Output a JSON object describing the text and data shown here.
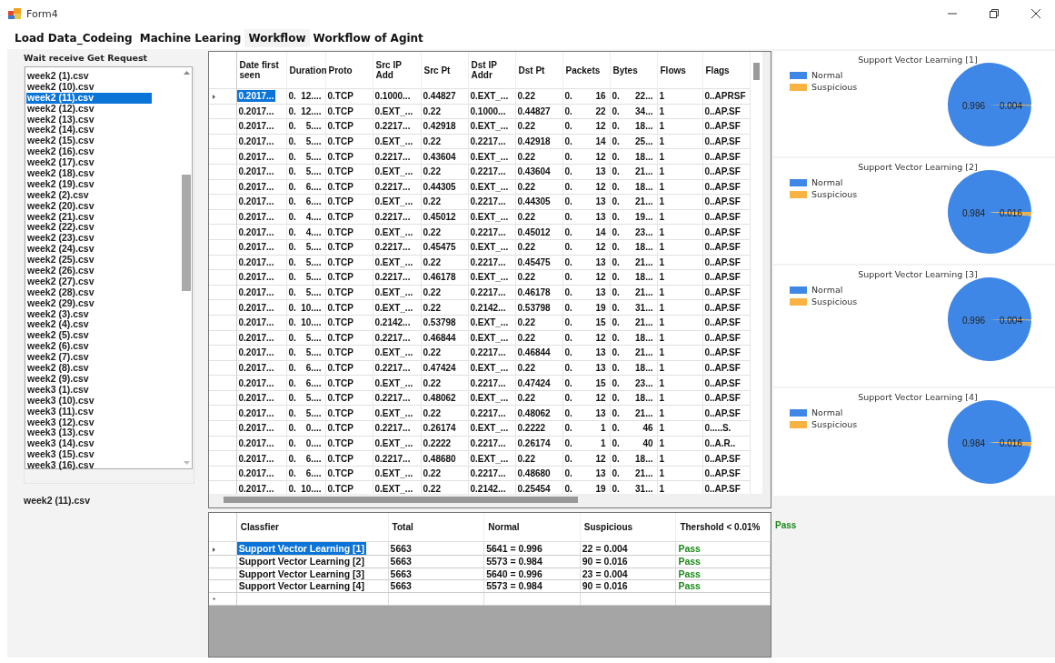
{
  "window": {
    "title": "Form4"
  },
  "tabs": [
    {
      "label": "Load Data_Codeing",
      "selected": false
    },
    {
      "label": "Machine Learing",
      "selected": false
    },
    {
      "label": "Workflow",
      "selected": true
    },
    {
      "label": "Workflow of Agint",
      "selected": false
    }
  ],
  "file_list": {
    "label": "Wait  receive Get Request",
    "current_file": "week2 (11).csv",
    "items": [
      {
        "name": "week2 (1).csv",
        "selected": false
      },
      {
        "name": "week2 (10).csv",
        "selected": false
      },
      {
        "name": "week2 (11).csv",
        "selected": true
      },
      {
        "name": "week2 (12).csv",
        "selected": false
      },
      {
        "name": "week2 (13).csv",
        "selected": false
      },
      {
        "name": "week2 (14).csv",
        "selected": false
      },
      {
        "name": "week2 (15).csv",
        "selected": false
      },
      {
        "name": "week2 (16).csv",
        "selected": false
      },
      {
        "name": "week2 (17).csv",
        "selected": false
      },
      {
        "name": "week2 (18).csv",
        "selected": false
      },
      {
        "name": "week2 (19).csv",
        "selected": false
      },
      {
        "name": "week2 (2).csv",
        "selected": false
      },
      {
        "name": "week2 (20).csv",
        "selected": false
      },
      {
        "name": "week2 (21).csv",
        "selected": false
      },
      {
        "name": "week2 (22).csv",
        "selected": false
      },
      {
        "name": "week2 (23).csv",
        "selected": false
      },
      {
        "name": "week2 (24).csv",
        "selected": false
      },
      {
        "name": "week2 (25).csv",
        "selected": false
      },
      {
        "name": "week2 (26).csv",
        "selected": false
      },
      {
        "name": "week2 (27).csv",
        "selected": false
      },
      {
        "name": "week2 (28).csv",
        "selected": false
      },
      {
        "name": "week2 (29).csv",
        "selected": false
      },
      {
        "name": "week2 (3).csv",
        "selected": false
      },
      {
        "name": "week2 (4).csv",
        "selected": false
      },
      {
        "name": "week2 (5).csv",
        "selected": false
      },
      {
        "name": "week2 (6).csv",
        "selected": false
      },
      {
        "name": "week2 (7).csv",
        "selected": false
      },
      {
        "name": "week2 (8).csv",
        "selected": false
      },
      {
        "name": "week2 (9).csv",
        "selected": false
      },
      {
        "name": "week3 (1).csv",
        "selected": false
      },
      {
        "name": "week3 (10).csv",
        "selected": false
      },
      {
        "name": "week3 (11).csv",
        "selected": false
      },
      {
        "name": "week3 (12).csv",
        "selected": false
      },
      {
        "name": "week3 (13).csv",
        "selected": false
      },
      {
        "name": "week3 (14).csv",
        "selected": false
      },
      {
        "name": "week3 (15).csv",
        "selected": false
      },
      {
        "name": "week3 (16).csv",
        "selected": false
      }
    ]
  },
  "flow_table": {
    "columns": [
      "Date first seen",
      "Duration",
      "Proto",
      "Src IP Add",
      "Src Pt",
      "Dst IP Addr",
      "Dst Pt",
      "Packets",
      "Bytes",
      "Flows",
      "Flags"
    ],
    "rows": [
      {
        "selected": true,
        "cells": [
          "0.2017...",
          [
            "0.",
            "12...."
          ],
          "0.TCP",
          "0.1000...",
          "0.44827",
          "0.EXT_...",
          "0.22",
          [
            "0.",
            "16"
          ],
          [
            "0.",
            "22..."
          ],
          "1",
          "0..APRSF"
        ]
      },
      {
        "selected": false,
        "cells": [
          "0.2017...",
          [
            "0.",
            "12...."
          ],
          "0.TCP",
          "0.EXT_...",
          "0.22",
          "0.1000...",
          "0.44827",
          [
            "0.",
            "22"
          ],
          [
            "0.",
            "34..."
          ],
          "1",
          "0..AP.SF"
        ]
      },
      {
        "selected": false,
        "cells": [
          "0.2017...",
          [
            "0.",
            "5...."
          ],
          "0.TCP",
          "0.2217...",
          "0.42918",
          "0.EXT_...",
          "0.22",
          [
            "0.",
            "12"
          ],
          [
            "0.",
            "18..."
          ],
          "1",
          "0..AP.SF"
        ]
      },
      {
        "selected": false,
        "cells": [
          "0.2017...",
          [
            "0.",
            "5...."
          ],
          "0.TCP",
          "0.EXT_...",
          "0.22",
          "0.2217...",
          "0.42918",
          [
            "0.",
            "14"
          ],
          [
            "0.",
            "25..."
          ],
          "1",
          "0..AP.SF"
        ]
      },
      {
        "selected": false,
        "cells": [
          "0.2017...",
          [
            "0.",
            "5...."
          ],
          "0.TCP",
          "0.2217...",
          "0.43604",
          "0.EXT_...",
          "0.22",
          [
            "0.",
            "12"
          ],
          [
            "0.",
            "18..."
          ],
          "1",
          "0..AP.SF"
        ]
      },
      {
        "selected": false,
        "cells": [
          "0.2017...",
          [
            "0.",
            "5...."
          ],
          "0.TCP",
          "0.EXT_...",
          "0.22",
          "0.2217...",
          "0.43604",
          [
            "0.",
            "13"
          ],
          [
            "0.",
            "21..."
          ],
          "1",
          "0..AP.SF"
        ]
      },
      {
        "selected": false,
        "cells": [
          "0.2017...",
          [
            "0.",
            "6...."
          ],
          "0.TCP",
          "0.2217...",
          "0.44305",
          "0.EXT_...",
          "0.22",
          [
            "0.",
            "12"
          ],
          [
            "0.",
            "18..."
          ],
          "1",
          "0..AP.SF"
        ]
      },
      {
        "selected": false,
        "cells": [
          "0.2017...",
          [
            "0.",
            "6...."
          ],
          "0.TCP",
          "0.EXT_...",
          "0.22",
          "0.2217...",
          "0.44305",
          [
            "0.",
            "13"
          ],
          [
            "0.",
            "21..."
          ],
          "1",
          "0..AP.SF"
        ]
      },
      {
        "selected": false,
        "cells": [
          "0.2017...",
          [
            "0.",
            "4...."
          ],
          "0.TCP",
          "0.2217...",
          "0.45012",
          "0.EXT_...",
          "0.22",
          [
            "0.",
            "13"
          ],
          [
            "0.",
            "19..."
          ],
          "1",
          "0..AP.SF"
        ]
      },
      {
        "selected": false,
        "cells": [
          "0.2017...",
          [
            "0.",
            "4...."
          ],
          "0.TCP",
          "0.EXT_...",
          "0.22",
          "0.2217...",
          "0.45012",
          [
            "0.",
            "14"
          ],
          [
            "0.",
            "23..."
          ],
          "1",
          "0..AP.SF"
        ]
      },
      {
        "selected": false,
        "cells": [
          "0.2017...",
          [
            "0.",
            "5...."
          ],
          "0.TCP",
          "0.2217...",
          "0.45475",
          "0.EXT_...",
          "0.22",
          [
            "0.",
            "12"
          ],
          [
            "0.",
            "18..."
          ],
          "1",
          "0..AP.SF"
        ]
      },
      {
        "selected": false,
        "cells": [
          "0.2017...",
          [
            "0.",
            "5...."
          ],
          "0.TCP",
          "0.EXT_...",
          "0.22",
          "0.2217...",
          "0.45475",
          [
            "0.",
            "13"
          ],
          [
            "0.",
            "21..."
          ],
          "1",
          "0..AP.SF"
        ]
      },
      {
        "selected": false,
        "cells": [
          "0.2017...",
          [
            "0.",
            "5...."
          ],
          "0.TCP",
          "0.2217...",
          "0.46178",
          "0.EXT_...",
          "0.22",
          [
            "0.",
            "12"
          ],
          [
            "0.",
            "18..."
          ],
          "1",
          "0..AP.SF"
        ]
      },
      {
        "selected": false,
        "cells": [
          "0.2017...",
          [
            "0.",
            "5...."
          ],
          "0.TCP",
          "0.EXT_...",
          "0.22",
          "0.2217...",
          "0.46178",
          [
            "0.",
            "13"
          ],
          [
            "0.",
            "21..."
          ],
          "1",
          "0..AP.SF"
        ]
      },
      {
        "selected": false,
        "cells": [
          "0.2017...",
          [
            "0.",
            "10...."
          ],
          "0.TCP",
          "0.EXT_...",
          "0.22",
          "0.2142...",
          "0.53798",
          [
            "0.",
            "19"
          ],
          [
            "0.",
            "31..."
          ],
          "1",
          "0..AP.SF"
        ]
      },
      {
        "selected": false,
        "cells": [
          "0.2017...",
          [
            "0.",
            "10...."
          ],
          "0.TCP",
          "0.2142...",
          "0.53798",
          "0.EXT_...",
          "0.22",
          [
            "0.",
            "15"
          ],
          [
            "0.",
            "21..."
          ],
          "1",
          "0..AP.SF"
        ]
      },
      {
        "selected": false,
        "cells": [
          "0.2017...",
          [
            "0.",
            "5...."
          ],
          "0.TCP",
          "0.2217...",
          "0.46844",
          "0.EXT_...",
          "0.22",
          [
            "0.",
            "12"
          ],
          [
            "0.",
            "18..."
          ],
          "1",
          "0..AP.SF"
        ]
      },
      {
        "selected": false,
        "cells": [
          "0.2017...",
          [
            "0.",
            "5...."
          ],
          "0.TCP",
          "0.EXT_...",
          "0.22",
          "0.2217...",
          "0.46844",
          [
            "0.",
            "13"
          ],
          [
            "0.",
            "21..."
          ],
          "1",
          "0..AP.SF"
        ]
      },
      {
        "selected": false,
        "cells": [
          "0.2017...",
          [
            "0.",
            "6...."
          ],
          "0.TCP",
          "0.2217...",
          "0.47424",
          "0.EXT_...",
          "0.22",
          [
            "0.",
            "13"
          ],
          [
            "0.",
            "18..."
          ],
          "1",
          "0..AP.SF"
        ]
      },
      {
        "selected": false,
        "cells": [
          "0.2017...",
          [
            "0.",
            "6...."
          ],
          "0.TCP",
          "0.EXT_...",
          "0.22",
          "0.2217...",
          "0.47424",
          [
            "0.",
            "15"
          ],
          [
            "0.",
            "23..."
          ],
          "1",
          "0..AP.SF"
        ]
      },
      {
        "selected": false,
        "cells": [
          "0.2017...",
          [
            "0.",
            "5...."
          ],
          "0.TCP",
          "0.2217...",
          "0.48062",
          "0.EXT_...",
          "0.22",
          [
            "0.",
            "12"
          ],
          [
            "0.",
            "18..."
          ],
          "1",
          "0..AP.SF"
        ]
      },
      {
        "selected": false,
        "cells": [
          "0.2017...",
          [
            "0.",
            "5...."
          ],
          "0.TCP",
          "0.EXT_...",
          "0.22",
          "0.2217...",
          "0.48062",
          [
            "0.",
            "13"
          ],
          [
            "0.",
            "21..."
          ],
          "1",
          "0..AP.SF"
        ]
      },
      {
        "selected": false,
        "cells": [
          "0.2017...",
          [
            "0.",
            "0...."
          ],
          "0.TCP",
          "0.2217...",
          "0.26174",
          "0.EXT_...",
          "0.2222",
          [
            "0.",
            "1"
          ],
          [
            "0.",
            "46"
          ],
          "1",
          "0.....S."
        ]
      },
      {
        "selected": false,
        "cells": [
          "0.2017...",
          [
            "0.",
            "0...."
          ],
          "0.TCP",
          "0.EXT_...",
          "0.2222",
          "0.2217...",
          "0.26174",
          [
            "0.",
            "1"
          ],
          [
            "0.",
            "40"
          ],
          "1",
          "0..A.R.."
        ]
      },
      {
        "selected": false,
        "cells": [
          "0.2017...",
          [
            "0.",
            "6...."
          ],
          "0.TCP",
          "0.2217...",
          "0.48680",
          "0.EXT_...",
          "0.22",
          [
            "0.",
            "12"
          ],
          [
            "0.",
            "18..."
          ],
          "1",
          "0..AP.SF"
        ]
      },
      {
        "selected": false,
        "cells": [
          "0.2017...",
          [
            "0.",
            "6...."
          ],
          "0.TCP",
          "0.EXT_...",
          "0.22",
          "0.2217...",
          "0.48680",
          [
            "0.",
            "13"
          ],
          [
            "0.",
            "21..."
          ],
          "1",
          "0..AP.SF"
        ]
      },
      {
        "selected": false,
        "cells": [
          "0.2017...",
          [
            "0.",
            "10...."
          ],
          "0.TCP",
          "0.EXT_...",
          "0.22",
          "0.2142...",
          "0.25454",
          [
            "0.",
            "19"
          ],
          [
            "0.",
            "31..."
          ],
          "1",
          "0..AP.SF"
        ]
      }
    ]
  },
  "results_table": {
    "columns": [
      "Classfier",
      "Total",
      "Normal",
      "Suspicious",
      "Thershold < 0.01%"
    ],
    "new_row_marker": "*",
    "rows": [
      {
        "selected": true,
        "cells": [
          "Support Vector Learning [1]",
          "5663",
          "5641 = 0.996",
          "22 = 0.004",
          "Pass"
        ]
      },
      {
        "selected": false,
        "cells": [
          "Support Vector Learning [2]",
          "5663",
          "5573 = 0.984",
          "90 = 0.016",
          "Pass"
        ]
      },
      {
        "selected": false,
        "cells": [
          "Support Vector Learning [3]",
          "5663",
          "5640 = 0.996",
          "23 = 0.004",
          "Pass"
        ]
      },
      {
        "selected": false,
        "cells": [
          "Support Vector Learning [4]",
          "5663",
          "5573 = 0.984",
          "90 = 0.016",
          "Pass"
        ]
      }
    ]
  },
  "charts": [
    {
      "chart_data": {
        "type": "pie",
        "title": "Support Vector Learning [1]",
        "categories": [
          "Normal",
          "Suspicious"
        ],
        "values": [
          0.996,
          0.004
        ],
        "colors": [
          "#3f87e6",
          "#f8b342"
        ],
        "value_labels": [
          "0.996",
          "0.004"
        ],
        "legend": "left"
      }
    },
    {
      "chart_data": {
        "type": "pie",
        "title": "Support Vector Learning [2]",
        "categories": [
          "Normal",
          "Suspicious"
        ],
        "values": [
          0.984,
          0.016
        ],
        "colors": [
          "#3f87e6",
          "#f8b342"
        ],
        "value_labels": [
          "0.984",
          "0.016"
        ],
        "legend": "left"
      }
    },
    {
      "chart_data": {
        "type": "pie",
        "title": "Support Vector Learning [3]",
        "categories": [
          "Normal",
          "Suspicious"
        ],
        "values": [
          0.996,
          0.004
        ],
        "colors": [
          "#3f87e6",
          "#f8b342"
        ],
        "value_labels": [
          "0.996",
          "0.004"
        ],
        "legend": "left"
      }
    },
    {
      "chart_data": {
        "type": "pie",
        "title": "Support Vector Learning [4]",
        "categories": [
          "Normal",
          "Suspicious"
        ],
        "values": [
          0.984,
          0.016
        ],
        "colors": [
          "#3f87e6",
          "#f8b342"
        ],
        "value_labels": [
          "0.984",
          "0.016"
        ],
        "legend": "left"
      }
    }
  ],
  "status": "Pass"
}
